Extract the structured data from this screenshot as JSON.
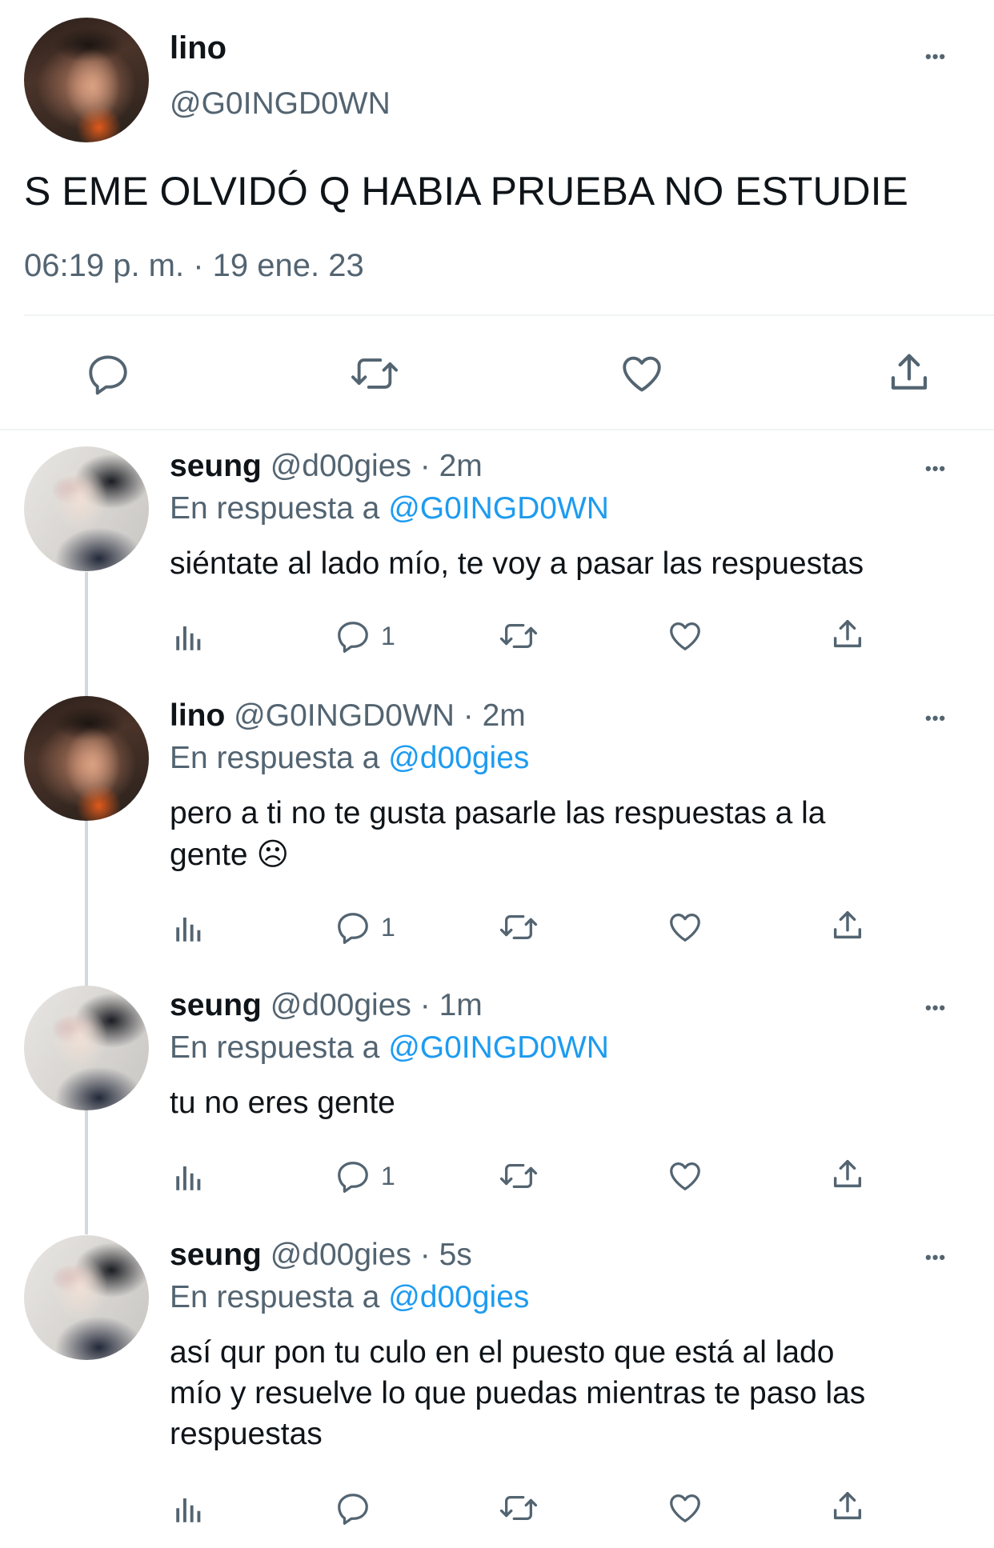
{
  "main_tweet": {
    "display_name": "lino",
    "handle": "@G0INGD0WN",
    "text": "S EME OLVIDÓ Q HABIA PRUEBA NO ESTUDIE",
    "timestamp": "06:19 p. m. · 19 ene. 23",
    "more": "•••"
  },
  "replies": [
    {
      "display_name": "seung",
      "handle": "@d00gies",
      "time": "· 2m",
      "reply_prefix": "En respuesta a",
      "reply_to": "@G0INGD0WN",
      "text": "siéntate al lado mío, te voy a pasar las respuestas",
      "reply_count": "1",
      "more": "•••"
    },
    {
      "display_name": "lino",
      "handle": "@G0INGD0WN",
      "time": "· 2m",
      "reply_prefix": "En respuesta a",
      "reply_to": "@d00gies",
      "text_line1": "pero a ti no te gusta pasarle las respuestas a la",
      "text_line2": "gente ☹",
      "reply_count": "1",
      "more": "•••"
    },
    {
      "display_name": "seung",
      "handle": "@d00gies",
      "time": "· 1m",
      "reply_prefix": "En respuesta a",
      "reply_to": "@G0INGD0WN",
      "text": "tu no eres gente",
      "reply_count": "1",
      "more": "•••"
    },
    {
      "display_name": "seung",
      "handle": "@d00gies",
      "time": "· 5s",
      "reply_prefix": "En respuesta a",
      "reply_to": "@d00gies",
      "text_line1": "así qur pon tu culo en el puesto que está al lado",
      "text_line2": "mío y resuelve lo que puedas mientras te paso las",
      "text_line3": "respuestas",
      "reply_count": "",
      "more": "•••"
    }
  ],
  "icons": {
    "reply": "speech-bubble-icon",
    "retweet": "retweet-arrows-icon",
    "like": "heart-icon",
    "share": "share-upload-icon",
    "analytics": "bar-chart-icon",
    "more": "more-dots-icon"
  },
  "colors": {
    "link": "#1d9bf0",
    "muted": "#536471",
    "text": "#0f1419",
    "thread_line": "#cfd9de"
  }
}
